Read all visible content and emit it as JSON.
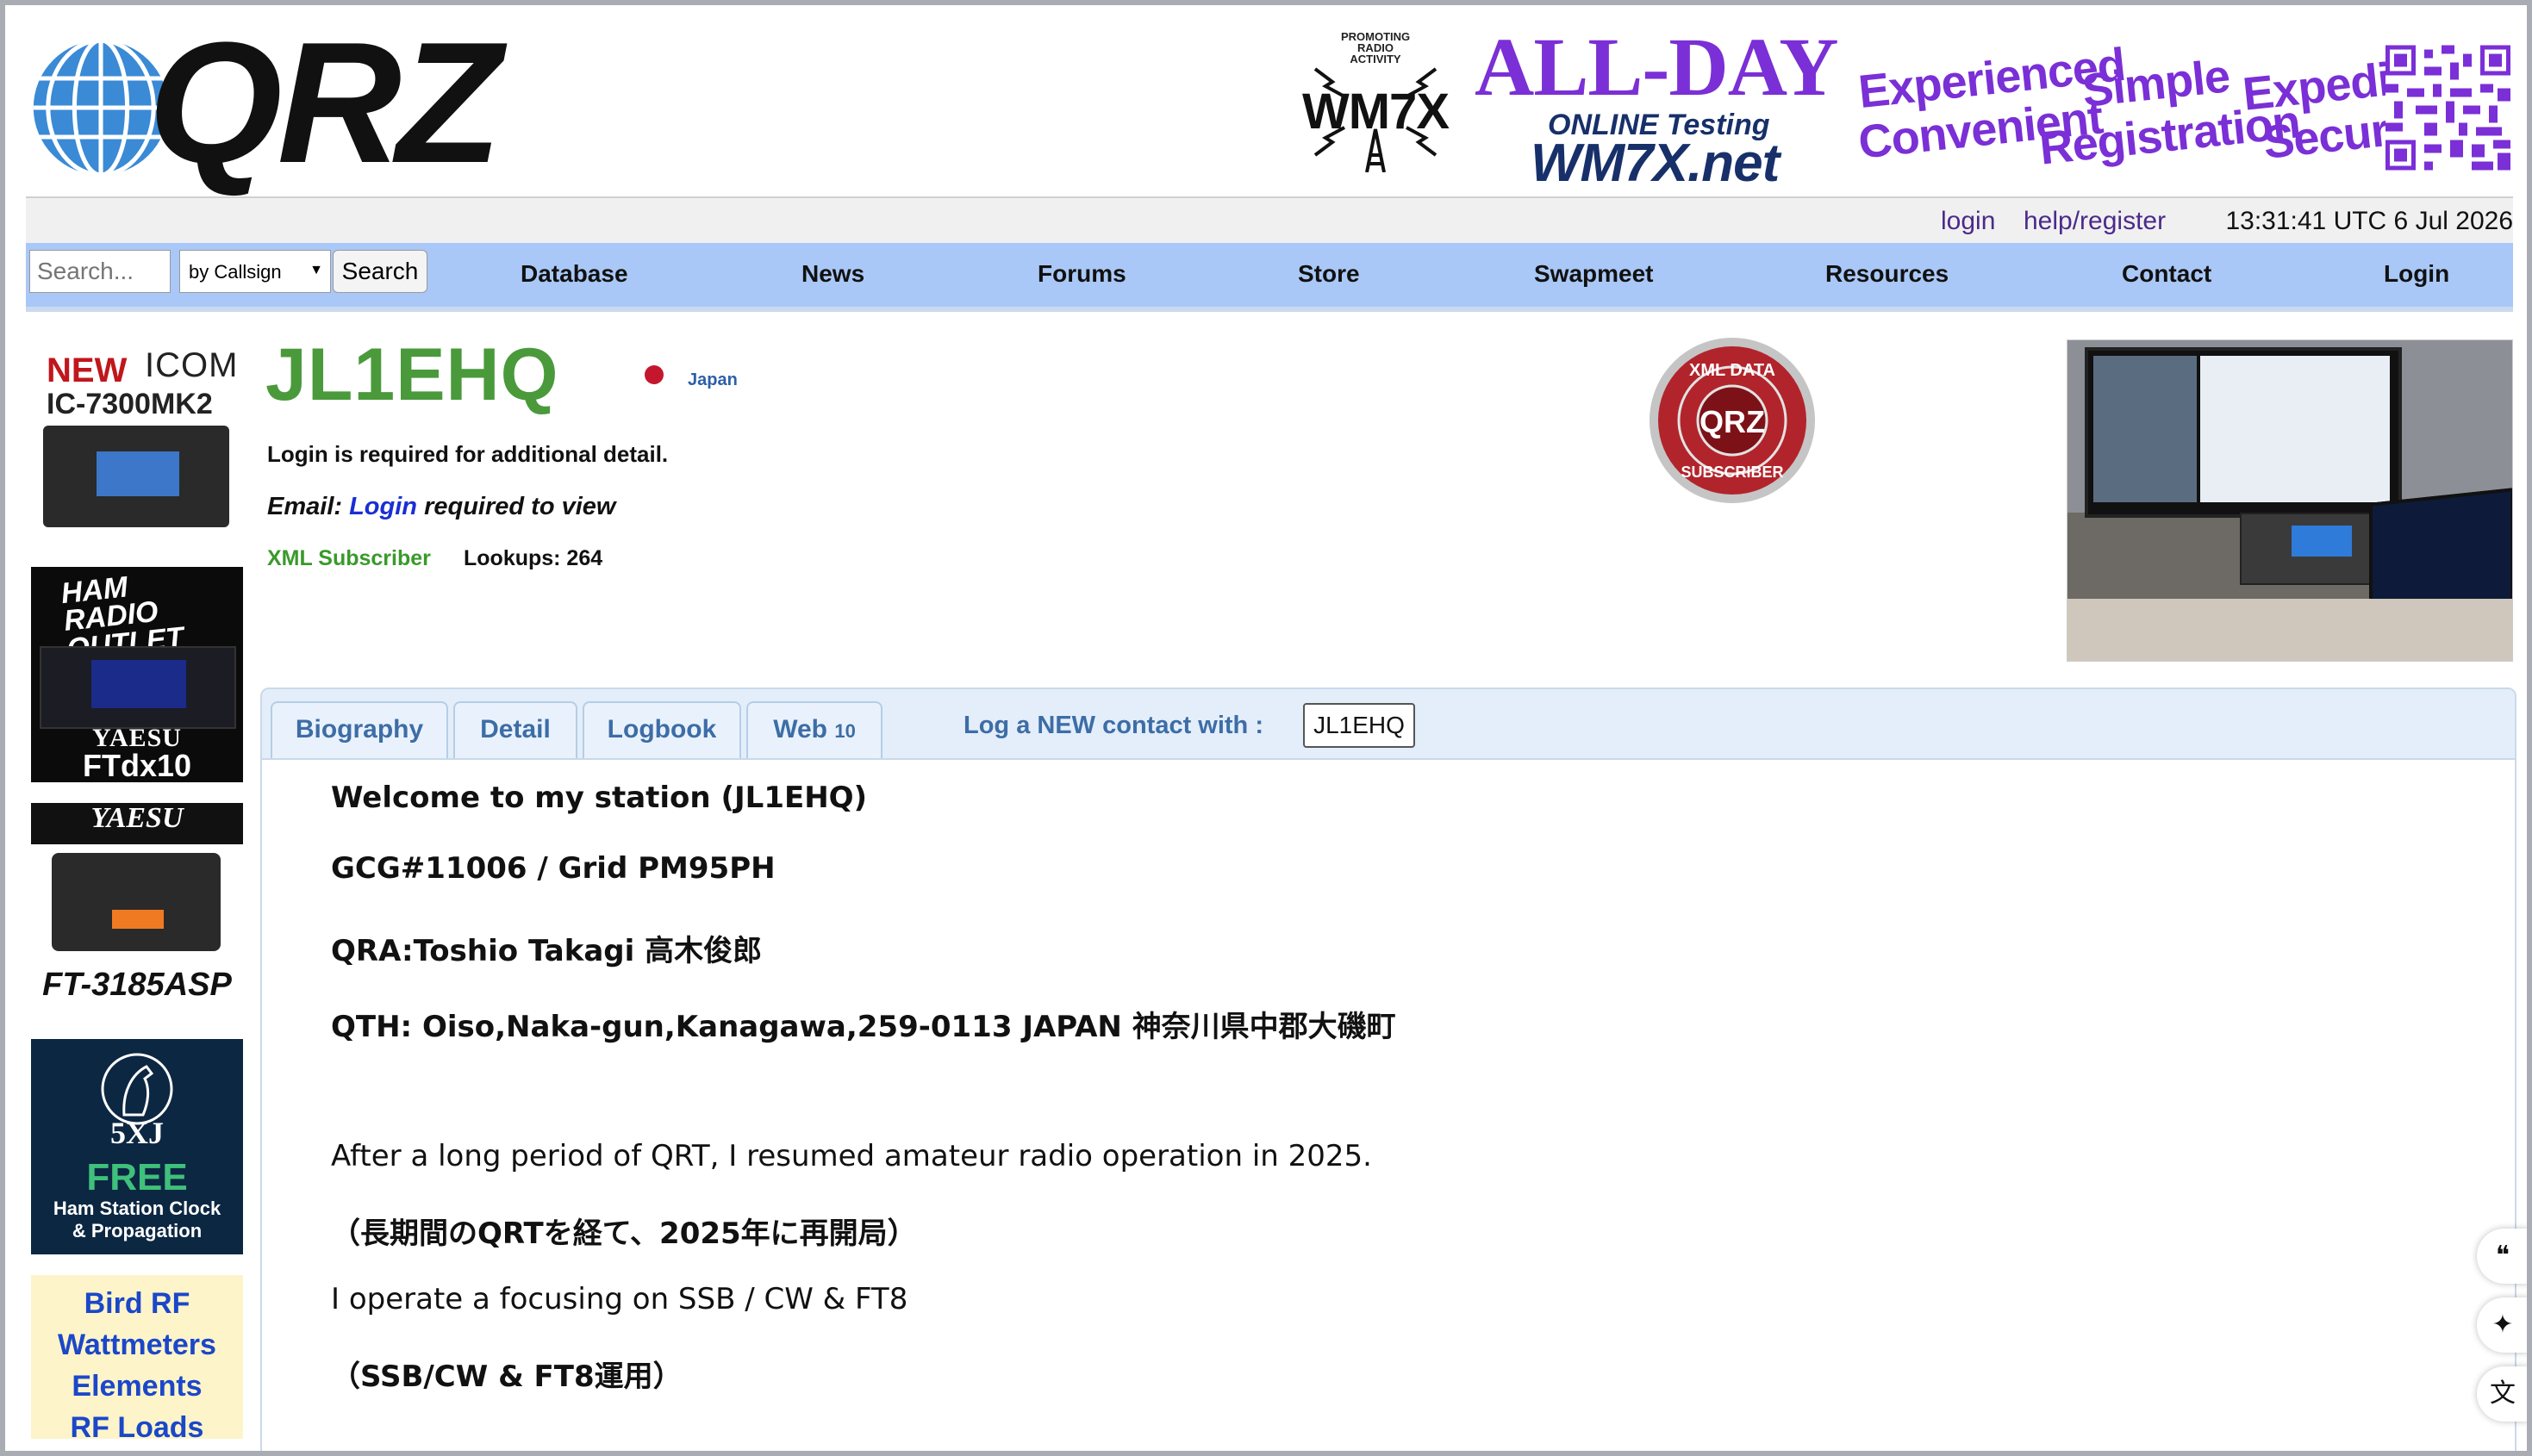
{
  "logo": {
    "text": "QRZ"
  },
  "banner": {
    "badge_top": "PROMOTING RADIO ACTIVITY",
    "badge_call": "WM7X",
    "headline": "ALL-DAY",
    "subline": "ONLINE Testing",
    "site": "WM7X.net",
    "words": [
      "Experienced",
      "Convenient",
      "Simple",
      "Registration",
      "Expedited",
      "Secure"
    ]
  },
  "status_bar": {
    "login": "login",
    "help_register": "help/register",
    "time": "13:31:41 UTC 6 Jul 2026"
  },
  "search": {
    "placeholder": "Search...",
    "mode": "by Callsign",
    "button": "Search"
  },
  "nav": [
    "Database",
    "News",
    "Forums",
    "Store",
    "Swapmeet",
    "Resources",
    "Contact",
    "Login"
  ],
  "sidebar_ads": {
    "icom": {
      "new": "NEW",
      "brand": "ICOM",
      "model": "IC-7300MK2"
    },
    "hro": {
      "logo_line1": "HAM",
      "logo_line2": "RADIO",
      "logo_line3": "OUTLET",
      "brand": "YAESU",
      "model": "FTdx10"
    },
    "ft3185": {
      "brand": "YAESU",
      "model": "FT-3185ASP"
    },
    "fivexj": {
      "brand": "5XJ",
      "free": "FREE",
      "line1": "Ham Station Clock",
      "line2": "& Propagation"
    },
    "bird": [
      "Bird RF",
      "Wattmeters",
      "Elements",
      "RF Loads"
    ]
  },
  "profile": {
    "callsign": "JL1EHQ",
    "country": "Japan",
    "login_note": "Login is required for additional detail.",
    "email_label": "Email:",
    "email_link": "Login",
    "email_suffix": "required to view",
    "xml_subscriber": "XML Subscriber",
    "lookups": "Lookups: 264",
    "badge_text_top": "XML DATA",
    "badge_text_mid": "QRZ",
    "badge_text_bottom": "SUBSCRIBER"
  },
  "tabs": [
    {
      "label": "Biography"
    },
    {
      "label": "Detail"
    },
    {
      "label": "Logbook"
    },
    {
      "label": "Web",
      "count": "10"
    }
  ],
  "log_contact": {
    "label": "Log a NEW contact with :",
    "value": "JL1EHQ"
  },
  "bio": [
    "Welcome to my station (JL1EHQ)",
    " GCG#11006  / Grid  PM95PH",
    " QRA:Toshio Takagi  高木俊郎",
    " QTH:  Oiso,Naka-gun,Kanagawa,259-0113 JAPAN 神奈川県中郡大磯町",
    "After a long period of QRT, I resumed amateur radio operation in 2025.",
    " （長期間のQRTを経て、2025年に再開局）",
    "I operate a focusing on SSB / CW & FT8",
    " （SSB/CW & FT8運用）"
  ],
  "float_icons": [
    "quote-icon",
    "sparkle-icon",
    "translate-icon"
  ],
  "colors": {
    "navbar": "#a9c8f7",
    "callsign": "#4a9a3b",
    "ad_purple": "#7b2fd6",
    "tab_text": "#3d6da6"
  }
}
